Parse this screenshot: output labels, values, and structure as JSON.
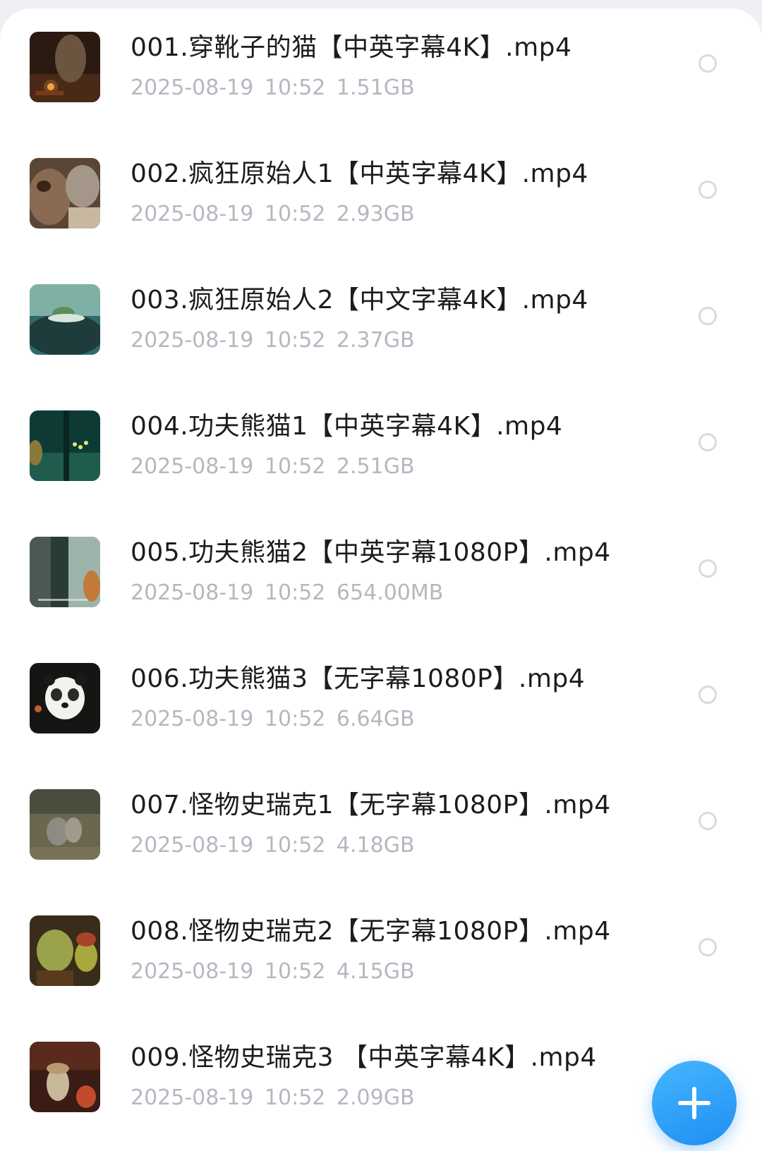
{
  "files": [
    {
      "name": "001.穿靴子的猫【中英字幕4K】.mp4",
      "date": "2025-08-19",
      "time": "10:52",
      "size": "1.51GB",
      "thumb": "puss-in-boots-thumbnail"
    },
    {
      "name": "002.疯狂原始人1【中英字幕4K】.mp4",
      "date": "2025-08-19",
      "time": "10:52",
      "size": "2.93GB",
      "thumb": "croods-1-thumbnail"
    },
    {
      "name": "003.疯狂原始人2【中文字幕4K】.mp4",
      "date": "2025-08-19",
      "time": "10:52",
      "size": "2.37GB",
      "thumb": "croods-2-thumbnail"
    },
    {
      "name": "004.功夫熊猫1【中英字幕4K】.mp4",
      "date": "2025-08-19",
      "time": "10:52",
      "size": "2.51GB",
      "thumb": "kung-fu-panda-1-thumbnail"
    },
    {
      "name": "005.功夫熊猫2【中英字幕1080P】.mp4",
      "date": "2025-08-19",
      "time": "10:52",
      "size": "654.00MB",
      "thumb": "kung-fu-panda-2-thumbnail"
    },
    {
      "name": "006.功夫熊猫3【无字幕1080P】.mp4",
      "date": "2025-08-19",
      "time": "10:52",
      "size": "6.64GB",
      "thumb": "kung-fu-panda-3-thumbnail"
    },
    {
      "name": "007.怪物史瑞克1【无字幕1080P】.mp4",
      "date": "2025-08-19",
      "time": "10:52",
      "size": "4.18GB",
      "thumb": "shrek-1-thumbnail"
    },
    {
      "name": "008.怪物史瑞克2【无字幕1080P】.mp4",
      "date": "2025-08-19",
      "time": "10:52",
      "size": "4.15GB",
      "thumb": "shrek-2-thumbnail"
    },
    {
      "name": "009.怪物史瑞克3 【中英字幕4K】.mp4",
      "date": "2025-08-19",
      "time": "10:52",
      "size": "2.09GB",
      "thumb": "shrek-3-thumbnail"
    }
  ],
  "fab": {
    "icon": "plus-icon"
  },
  "colors": {
    "title_text": "#1c1c1e",
    "meta_text": "#b4b8c0",
    "radio_border": "#d8dadf",
    "fab_accent": "#2a9cf7",
    "background": "#eef0f4"
  }
}
